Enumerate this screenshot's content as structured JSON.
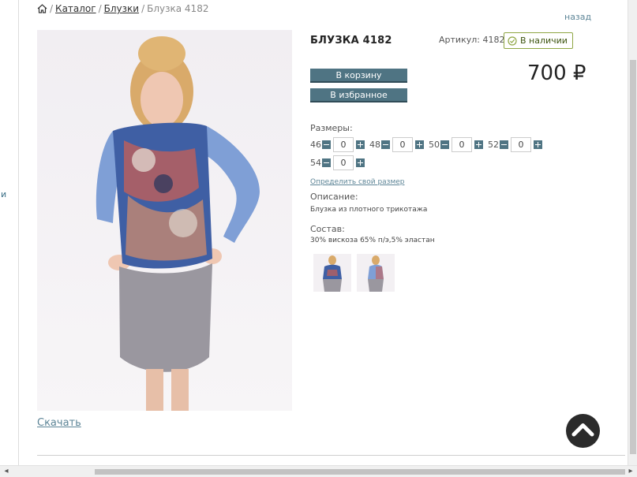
{
  "breadcrumb": {
    "catalog": "Каталог",
    "category": "Блузки",
    "current": "Блузка 4182",
    "separator": "/"
  },
  "back_link": "назад",
  "left_rail_cut_text": "и",
  "product": {
    "title": "БЛУЗКА 4182",
    "article_label": "Артикул:",
    "article_value": "4182",
    "stock": "В наличии",
    "price": "700 ₽",
    "add_to_cart": "В корзину",
    "add_to_favorites": "В избранное",
    "sizes_label": "Размеры:",
    "sizes": [
      {
        "size": "46",
        "qty": "0"
      },
      {
        "size": "48",
        "qty": "0"
      },
      {
        "size": "50",
        "qty": "0"
      },
      {
        "size": "52",
        "qty": "0"
      },
      {
        "size": "54",
        "qty": "0"
      }
    ],
    "size_help_link": "Определить свой размер",
    "description_label": "Описание:",
    "description": "Блузка из плотного трикотажа",
    "composition_label": "Состав:",
    "composition": "30% вискоза 65% п/э,5% эластан",
    "download": "Скачать"
  },
  "colors": {
    "button": "#4f7483",
    "link": "#5d8597",
    "stock_border": "#8fa644",
    "scroll_top_bg": "#2b2b2b"
  }
}
